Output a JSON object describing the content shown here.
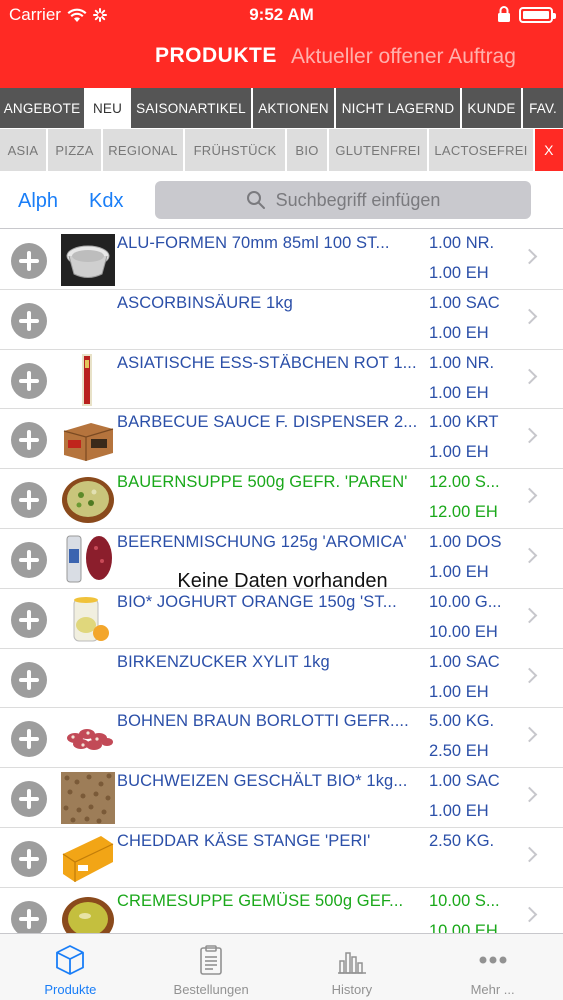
{
  "status_bar": {
    "carrier": "Carrier",
    "time": "9:52 AM"
  },
  "nav": {
    "title": "PRODUKTE",
    "subtitle": "Aktueller offener Auftrag"
  },
  "tabs_row1": [
    "ANGEBOTE",
    "NEU",
    "SAISONARTIKEL",
    "AKTIONEN",
    "NICHT LAGERND",
    "KUNDE",
    "FAV."
  ],
  "tabs_row1_active": "NEU",
  "tabs_row2": [
    "ASIA",
    "PIZZA",
    "REGIONAL",
    "FRÜHSTÜCK",
    "BIO",
    "GLUTENFREI",
    "LACTOSEFREI",
    "X"
  ],
  "sort": {
    "alph": "Alph",
    "kdx": "Kdx"
  },
  "search": {
    "placeholder": "Suchbegriff einfügen"
  },
  "empty_message": "Keine Daten vorhanden",
  "products": [
    {
      "name": "ALU-FORMEN 70mm 85ml 100 ST...",
      "qty1": "1.00 NR.",
      "qty2": "1.00 EH",
      "color": "blue",
      "thumb": "alu"
    },
    {
      "name": "ASCORBINSÄURE 1kg",
      "qty1": "1.00 SAC",
      "qty2": "1.00 EH",
      "color": "blue",
      "thumb": ""
    },
    {
      "name": "ASIATISCHE ESS-STÄBCHEN ROT 1...",
      "qty1": "1.00 NR.",
      "qty2": "1.00 EH",
      "color": "blue",
      "thumb": "sticks"
    },
    {
      "name": "BARBECUE SAUCE F. DISPENSER 2...",
      "qty1": "1.00 KRT",
      "qty2": "1.00 EH",
      "color": "blue",
      "thumb": "box"
    },
    {
      "name": "BAUERNSUPPE 500g GEFR. 'PAREN'",
      "qty1": "12.00 S...",
      "qty2": "12.00 EH",
      "color": "green",
      "thumb": "soup"
    },
    {
      "name": "BEERENMISCHUNG 125g 'AROMICA'",
      "qty1": "1.00 DOS",
      "qty2": "1.00 EH",
      "color": "blue",
      "thumb": "berries"
    },
    {
      "name": "BIO* JOGHURT ORANGE 150g 'ST...",
      "qty1": "10.00 G...",
      "qty2": "10.00 EH",
      "color": "blue",
      "thumb": "yogurt"
    },
    {
      "name": "BIRKENZUCKER XYLIT 1kg",
      "qty1": "1.00 SAC",
      "qty2": "1.00 EH",
      "color": "blue",
      "thumb": ""
    },
    {
      "name": "BOHNEN BRAUN BORLOTTI GEFR....",
      "qty1": "5.00 KG.",
      "qty2": "2.50 EH",
      "color": "blue",
      "thumb": "beans"
    },
    {
      "name": "BUCHWEIZEN GESCHÄLT BIO* 1kg...",
      "qty1": "1.00 SAC",
      "qty2": "1.00 EH",
      "color": "blue",
      "thumb": "grain"
    },
    {
      "name": "CHEDDAR KÄSE STANGE 'PERI'",
      "qty1": "2.50 KG.",
      "qty2": "",
      "color": "blue",
      "thumb": "cheese"
    },
    {
      "name": "CREMESUPPE GEMÜSE 500g GEF...",
      "qty1": "10.00 S...",
      "qty2": "10.00 EH",
      "color": "green",
      "thumb": "soup2"
    }
  ],
  "tabbar": [
    {
      "label": "Produkte",
      "icon": "cube-icon",
      "active": true
    },
    {
      "label": "Bestellungen",
      "icon": "clipboard-icon",
      "active": false
    },
    {
      "label": "History",
      "icon": "chart-icon",
      "active": false
    },
    {
      "label": "Mehr ...",
      "icon": "more-icon",
      "active": false
    }
  ],
  "colors": {
    "header": "#ff2a24",
    "accent": "#1a7ef7",
    "product_blue": "#2b4fa8",
    "product_green": "#1aa81a"
  }
}
